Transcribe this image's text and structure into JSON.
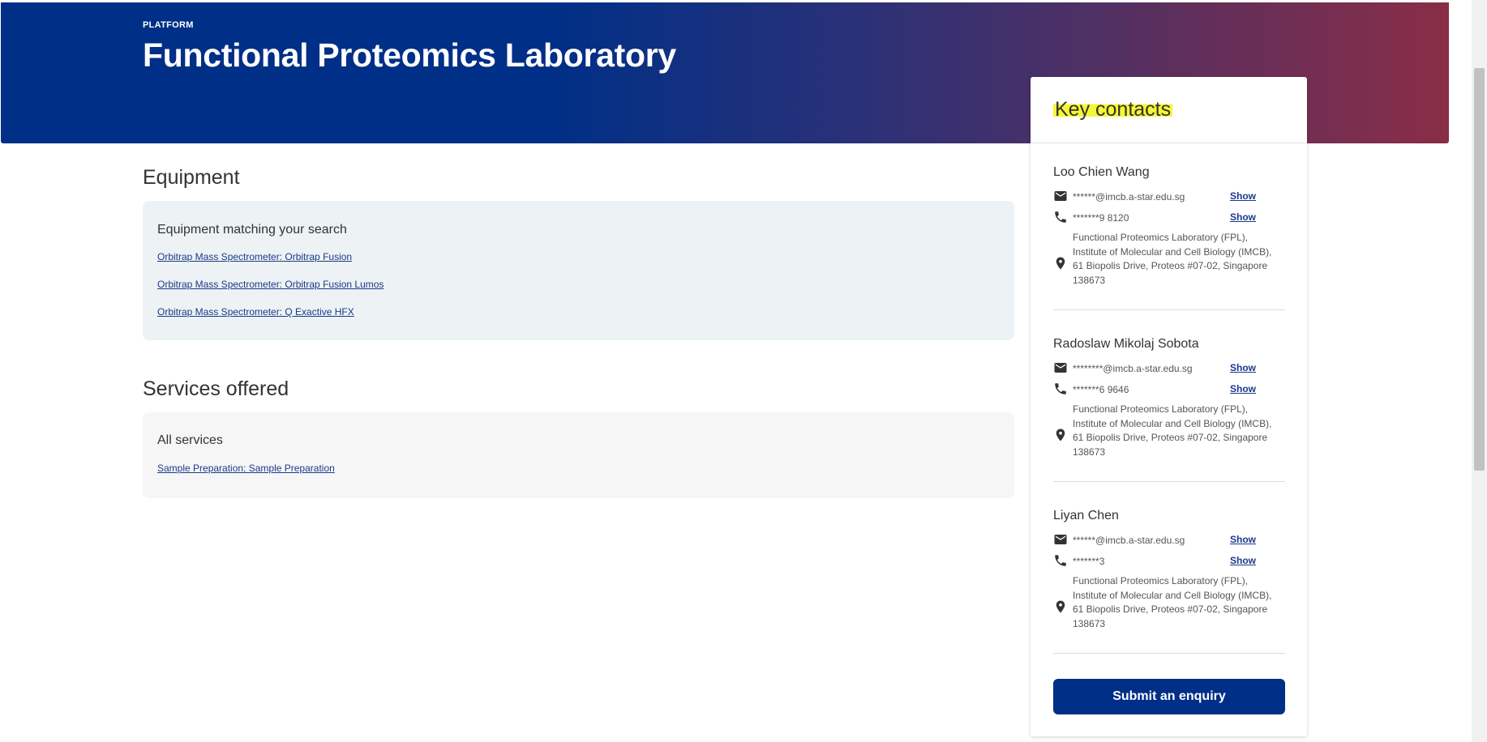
{
  "hero": {
    "eyebrow": "PLATFORM",
    "title": "Functional Proteomics Laboratory"
  },
  "equipment": {
    "heading": "Equipment",
    "panel_title": "Equipment matching your search",
    "links": [
      "Orbitrap Mass Spectrometer: Orbitrap Fusion",
      "Orbitrap Mass Spectrometer: Orbitrap Fusion Lumos",
      "Orbitrap Mass Spectrometer: Q Exactive HFX"
    ]
  },
  "services": {
    "heading": "Services offered",
    "panel_title": "All services",
    "links": [
      "Sample Preparation: Sample Preparation"
    ]
  },
  "contacts": {
    "title": "Key contacts",
    "show_label": "Show",
    "people": [
      {
        "name": "Loo Chien Wang",
        "email": "******@imcb.a-star.edu.sg",
        "phone": "*******9 8120",
        "address": "Functional Proteomics Laboratory (FPL), Institute of Molecular and Cell Biology (IMCB), 61 Biopolis Drive, Proteos #07-02, Singapore 138673"
      },
      {
        "name": "Radoslaw Mikolaj Sobota",
        "email": "********@imcb.a-star.edu.sg",
        "phone": "*******6 9646",
        "address": "Functional Proteomics Laboratory (FPL), Institute of Molecular and Cell Biology (IMCB), 61 Biopolis Drive, Proteos #07-02, Singapore 138673"
      },
      {
        "name": "Liyan Chen",
        "email": "******@imcb.a-star.edu.sg",
        "phone": "*******3",
        "address": "Functional Proteomics Laboratory (FPL), Institute of Molecular and Cell Biology (IMCB), 61 Biopolis Drive, Proteos #07-02, Singapore 138673"
      }
    ],
    "enquiry_label": "Submit an enquiry"
  },
  "colors": {
    "brand_blue": "#002f87",
    "brand_red": "#8a2d48",
    "highlight": "#f6f733"
  }
}
